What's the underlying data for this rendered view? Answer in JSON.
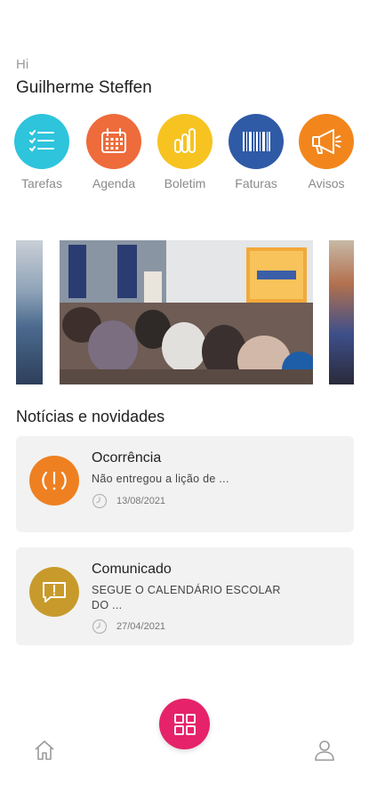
{
  "greeting": {
    "hi": "Hi",
    "name": "Guilherme Steffen"
  },
  "quick_actions": [
    {
      "label": "Tarefas",
      "color": "#2ec4dc",
      "icon": "checklist-icon"
    },
    {
      "label": "Agenda",
      "color": "#ee6b3b",
      "icon": "calendar-icon"
    },
    {
      "label": "Boletim",
      "color": "#f6c321",
      "icon": "bar-chart-icon"
    },
    {
      "label": "Faturas",
      "color": "#2f5aa6",
      "icon": "barcode-icon"
    },
    {
      "label": "Avisos",
      "color": "#f2861d",
      "icon": "megaphone-icon"
    }
  ],
  "news": {
    "title": "Notícias e novidades",
    "items": [
      {
        "title": "Ocorrência",
        "description": "Não entregou a lição de ...",
        "date": "13/08/2021",
        "color": "#ee8022",
        "icon": "alert-icon"
      },
      {
        "title": "Comunicado",
        "description": "SEGUE O CALENDÁRIO ESCOLAR DO ...",
        "date": "27/04/2021",
        "color": "#c79a2b",
        "icon": "message-alert-icon"
      }
    ]
  },
  "nav": {
    "fab_color": "#e5226a",
    "fab_icon": "grid-icon",
    "home_icon": "home-icon",
    "profile_icon": "profile-icon"
  }
}
